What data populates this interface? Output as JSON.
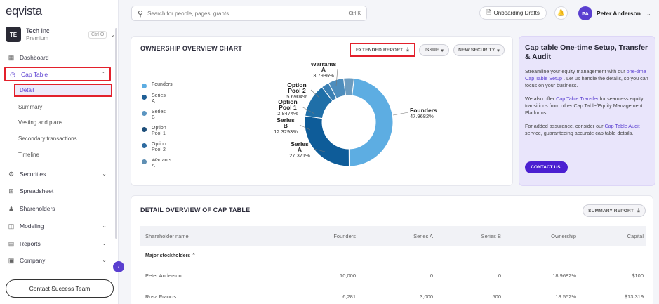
{
  "brand": {
    "logo": "eqvista",
    "accent": "#5a3fd0",
    "highlight": "#e3202b"
  },
  "company": {
    "initials": "TE",
    "name": "Tech Inc",
    "plan": "Premium",
    "shortcut": "Ctrl O"
  },
  "search": {
    "placeholder": "Search for people, pages, grants",
    "shortcut": "Ctrl K"
  },
  "topbar": {
    "drafts_label": "Onboarding Drafts",
    "user_initials": "PA",
    "user_name": "Peter Anderson"
  },
  "nav": {
    "dashboard": "Dashboard",
    "cap_table": "Cap Table",
    "sub": [
      "Detail",
      "Summary",
      "Vesting and plans",
      "Secondary transactions",
      "Timeline"
    ],
    "securities": "Securities",
    "spreadsheet": "Spreadsheet",
    "shareholders": "Shareholders",
    "modeling": "Modeling",
    "reports": "Reports",
    "company": "Company",
    "contact": "Contact Success Team"
  },
  "chart_card": {
    "title": "OWNERSHIP OVERVIEW CHART",
    "extended_report": "EXTENDED REPORT",
    "issue": "ISSUE",
    "new_security": "NEW SECURITY",
    "legend": [
      {
        "label": "Founders",
        "color": "#5dade2"
      },
      {
        "label": "Series A",
        "color": "#1f5f96"
      },
      {
        "label": "Series B",
        "color": "#5b95c1"
      },
      {
        "label": "Option Pool 1",
        "color": "#1e4f7a"
      },
      {
        "label": "Option Pool 2",
        "color": "#2d6aa0"
      },
      {
        "label": "Warrants A",
        "color": "#5f8fb3"
      }
    ]
  },
  "chart_data": {
    "type": "pie",
    "donut": true,
    "categories": [
      "Founders",
      "Series A",
      "Series B",
      "Option Pool 1",
      "Option Pool 2",
      "Warrants A"
    ],
    "values": [
      47.9682,
      27.371,
      12.3293,
      2.8474,
      5.6904,
      3.7936
    ],
    "value_labels": [
      "47.9682%",
      "27.371%",
      "12.3293%",
      "2.8474%",
      "5.6904%",
      "3.7936%"
    ],
    "colors": [
      "#5dade2",
      "#0e5c99",
      "#1f6fa8",
      "#3a7fb3",
      "#4d8dbd",
      "#6c9cc0"
    ],
    "title": "",
    "xlabel": "",
    "ylabel": ""
  },
  "setup": {
    "title": "Cap table One-time Setup, Transfer & Audit",
    "p1_a": "Streamline your equity management with our ",
    "p1_link": "one-time Cap Table Setup",
    "p1_b": " . Let us handle the details, so you can focus on your business.",
    "p2_a": "We also offer ",
    "p2_link": "Cap Table Transfer",
    "p2_b": " for seamless equity transitions from other Cap Table/Equity Management Platforms.",
    "p3_a": "For added assurance, consider our ",
    "p3_link": "Cap Table Audit",
    "p3_b": " service, guaranteeing accurate cap table details.",
    "button": "CONTACT US!"
  },
  "table": {
    "title": "DETAIL OVERVIEW OF CAP TABLE",
    "summary_report": "SUMMARY REPORT",
    "headers": [
      "Shareholder name",
      "Founders",
      "Series A",
      "Series B",
      "Ownership",
      "Capital"
    ],
    "group": "Major stockholders",
    "rows": [
      [
        "Peter Anderson",
        "10,000",
        "0",
        "0",
        "18.9682%",
        "$100"
      ],
      [
        "Rosa Francis",
        "6,281",
        "3,000",
        "500",
        "18.552%",
        "$13,319"
      ]
    ]
  }
}
